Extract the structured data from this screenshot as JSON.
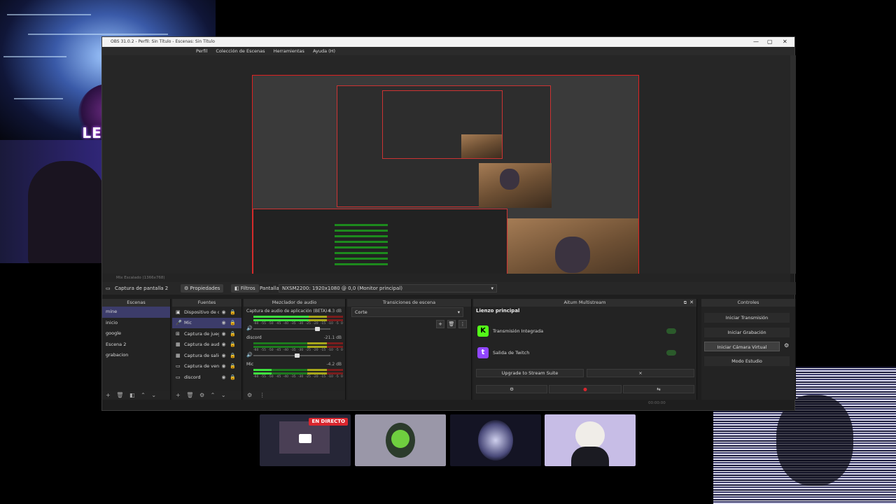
{
  "overlay": {
    "logo_text": "LEVEL"
  },
  "window": {
    "title": "OBS 31.0.2 - Perfil: Sin Título - Escenas: Sin Título",
    "controls": [
      "—",
      "▢",
      "✕"
    ]
  },
  "menu": [
    "Perfil",
    "Colección de Escenas",
    "Herramientas",
    "Ayuda (H)"
  ],
  "status_line": "Mix    Escalado (1366x768)",
  "toolbar": {
    "source_name": "Captura de pantalla 2",
    "properties": "Propiedades",
    "filters": "Filtros",
    "display_label": "Pantalla",
    "display_value": "NXSM2200: 1920x1080 @ 0,0 (Monitor principal)"
  },
  "docks": {
    "scenes": {
      "title": "Escenas",
      "items": [
        "mine",
        "inicio",
        "google",
        "Escena 2",
        "grabacion"
      ]
    },
    "sources": {
      "title": "Fuentes",
      "items": [
        {
          "label": "Dispositivo de c",
          "icon": "camera-icon"
        },
        {
          "label": "Mic",
          "icon": "mic-icon"
        },
        {
          "label": "Captura de jueg",
          "icon": "gamepad-icon"
        },
        {
          "label": "Captura de aud",
          "icon": "audio-capture-icon"
        },
        {
          "label": "Captura de salic",
          "icon": "audio-output-icon"
        },
        {
          "label": "Captura de ven",
          "icon": "window-icon"
        },
        {
          "label": "discord",
          "icon": "window-icon"
        }
      ]
    },
    "mixer": {
      "title": "Mezclador de audio",
      "channels": [
        {
          "name": "Captura de audio de aplicación (BETA) 4",
          "db": "-6.3 dB",
          "level": 0.62,
          "fader": 0.8
        },
        {
          "name": "discord",
          "db": "-21.1 dB",
          "level": 0.0,
          "fader": 0.54
        },
        {
          "name": "Mic",
          "db": "-4.2 dB",
          "level": 0.2,
          "fader": 0.8
        }
      ],
      "scale": [
        "-60",
        "-55",
        "-50",
        "-45",
        "-40",
        "-35",
        "-30",
        "-25",
        "-20",
        "-15",
        "-10",
        "-5",
        "0"
      ]
    },
    "transitions": {
      "title": "Transiciones de escena",
      "selected": "Corte"
    },
    "multistream": {
      "title": "Aitum Multistream",
      "section": "Lienzo principal",
      "outputs": [
        {
          "label": "Transmisión Integrada",
          "icon": "kick-icon",
          "color": "#53fc18",
          "glyph": "K"
        },
        {
          "label": "Salida de Twitch",
          "icon": "twitch-icon",
          "color": "#9146ff",
          "glyph": "t"
        }
      ],
      "upgrade": "Upgrade to Stream Suite",
      "close_glyph": "×"
    },
    "controls": {
      "title": "Controles",
      "buttons": [
        "Iniciar Transmisión",
        "Iniciar Grabación",
        "Iniciar Cámara Virtual",
        "Modo Estudio"
      ]
    },
    "stats": "00:00:00"
  },
  "bottom_cards": {
    "live_badge": "EN DIRECTO"
  },
  "colors": {
    "accent_red": "#d9262e",
    "selection": "#3c3c6a",
    "kick_green": "#53fc18",
    "twitch_purple": "#9146ff"
  }
}
